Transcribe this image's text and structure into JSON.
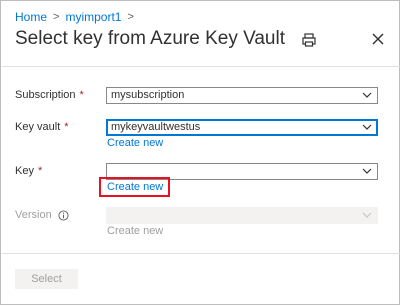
{
  "breadcrumb": {
    "items": [
      "Home",
      "myimport1"
    ]
  },
  "header": {
    "title": "Select key from Azure Key Vault"
  },
  "form": {
    "subscription": {
      "label": "Subscription",
      "required_mark": "*",
      "value": "mysubscription"
    },
    "key_vault": {
      "label": "Key vault",
      "required_mark": "*",
      "value": "mykeyvaultwestus",
      "create_new": "Create new"
    },
    "key": {
      "label": "Key",
      "required_mark": "*",
      "value": "",
      "create_new": "Create new"
    },
    "version": {
      "label": "Version",
      "value": "",
      "create_new": "Create new"
    }
  },
  "footer": {
    "select_label": "Select"
  },
  "colors": {
    "link": "#0078d4",
    "required": "#a4262c",
    "highlight": "#e81123",
    "disabled_text": "#a19f9d"
  },
  "icons": [
    "print-icon",
    "close-icon",
    "chevron-down-icon",
    "info-icon"
  ]
}
